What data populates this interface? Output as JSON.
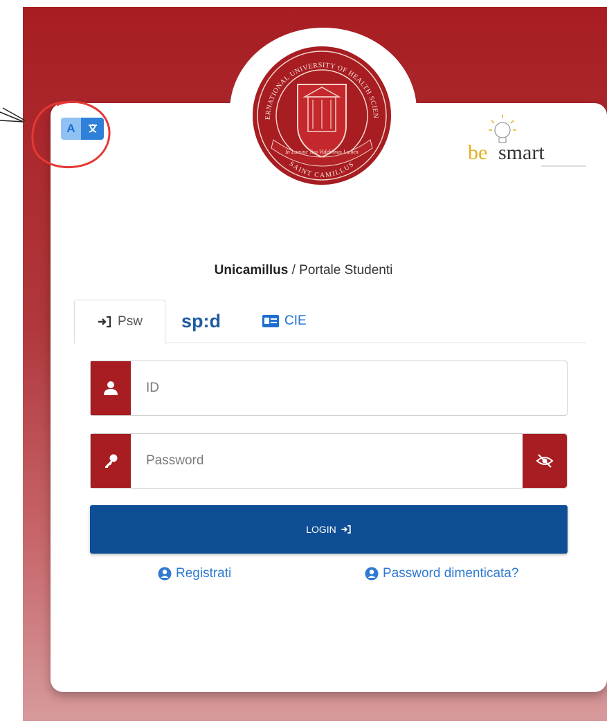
{
  "header": {
    "seal_text_top": "INTERNATIONAL UNIVERSITY OF HEALTH SCIENCES",
    "seal_motto": "In Lumine Tuo Videbimus Lumen",
    "seal_text_bottom": "SAINT CAMILLUS",
    "partner_logo": {
      "be": "be",
      "smart": "smart"
    },
    "lang_toggle": {
      "left_glyph": "A",
      "right_glyph": "文"
    }
  },
  "title": {
    "brand": "Unicamillus",
    "separator": " / ",
    "portal": "Portale Studenti"
  },
  "tabs": [
    {
      "icon": "sign-in-icon",
      "label": "Psw",
      "active": true
    },
    {
      "label": "sp:d",
      "active": false
    },
    {
      "icon": "id-card-icon",
      "label": "CIE",
      "active": false
    }
  ],
  "form": {
    "id_placeholder": "ID",
    "password_placeholder": "Password",
    "login_label": "LOGIN"
  },
  "links": {
    "register": "Registrati",
    "forgot": "Password dimenticata?"
  },
  "colors": {
    "brand_red": "#a71d22",
    "login_blue": "#0d4e94",
    "link_blue": "#2f7bd0",
    "annotation_red": "#e53935"
  }
}
